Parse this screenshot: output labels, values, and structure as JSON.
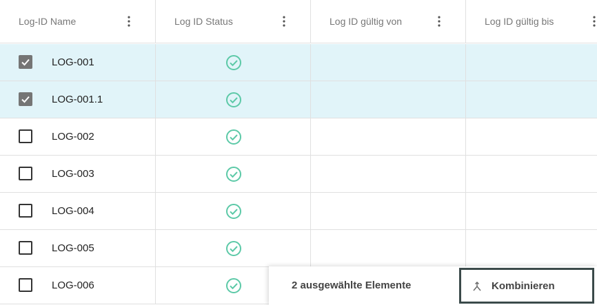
{
  "columns": [
    {
      "label": "Log-ID Name"
    },
    {
      "label": "Log ID Status"
    },
    {
      "label": "Log ID gültig von"
    },
    {
      "label": "Log ID gültig bis"
    }
  ],
  "rows": [
    {
      "name": "LOG-001",
      "selected": true,
      "status": "check-circle-icon"
    },
    {
      "name": "LOG-001.1",
      "selected": true,
      "status": "check-circle-icon"
    },
    {
      "name": "LOG-002",
      "selected": false,
      "status": "check-circle-icon"
    },
    {
      "name": "LOG-003",
      "selected": false,
      "status": "check-circle-icon"
    },
    {
      "name": "LOG-004",
      "selected": false,
      "status": "check-circle-icon"
    },
    {
      "name": "LOG-005",
      "selected": false,
      "status": "check-circle-icon"
    },
    {
      "name": "LOG-006",
      "selected": false,
      "status": "check-circle-icon"
    }
  ],
  "toolbar": {
    "selection_count_label": "2 ausgewählte Elemente",
    "combine_label": "Kombinieren",
    "combine_icon": "merge-icon"
  },
  "colors": {
    "selected_row": "#e1f4f9",
    "status_ok": "#5cc9a7",
    "checkbox_checked": "#757575",
    "focus_border": "#3b4a4a"
  }
}
